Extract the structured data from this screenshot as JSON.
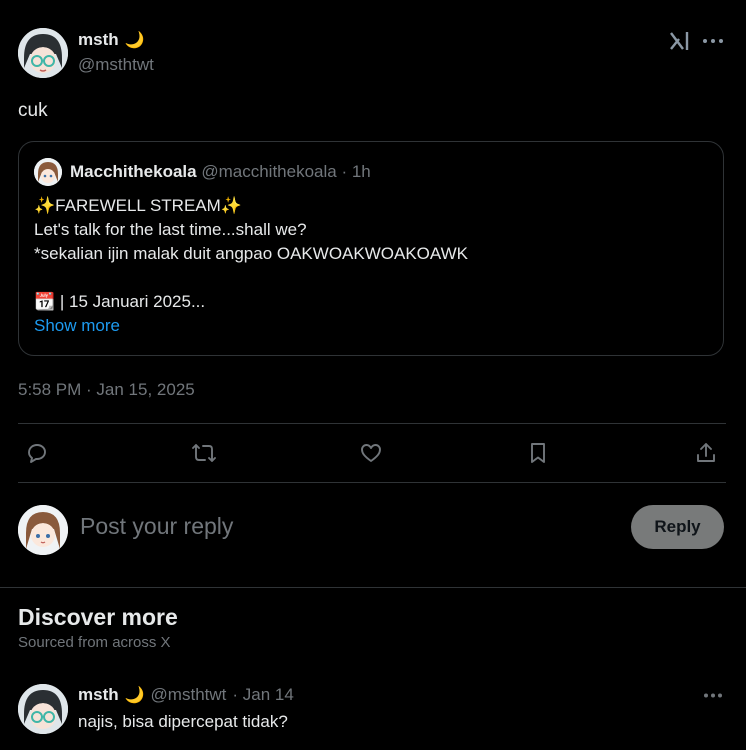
{
  "post": {
    "author_name": "msth",
    "author_emoji": "🌙",
    "author_handle": "@msthtwt",
    "text": "cuk",
    "timestamp": "5:58 PM · Jan 15, 2025"
  },
  "quote": {
    "author_name": "Macchithekoala",
    "author_handle": "@macchithekoala",
    "time": "· 1h",
    "line1": "✨FAREWELL STREAM✨",
    "line2": "Let's talk for the last time...shall we?",
    "line3": "*sekalian ijin malak duit angpao OAKWOAKWOAKOAWK",
    "line4": "📆 | 15 Januari 2025...",
    "show_more": "Show more"
  },
  "actions": [
    "reply-icon",
    "repost-icon",
    "like-icon",
    "bookmark-icon",
    "share-icon"
  ],
  "reply_box": {
    "placeholder": "Post your reply",
    "button": "Reply"
  },
  "discover": {
    "title": "Discover more",
    "subtitle": "Sourced from across X"
  },
  "feed_post": {
    "author_name": "msth",
    "author_emoji": "🌙",
    "author_handle": "@msthtwt",
    "time": "· Jan 14",
    "text": "najis, bisa dipercepat tidak?"
  },
  "colors": {
    "background": "#000000",
    "text": "#e7e9ea",
    "muted": "#71767b",
    "link": "#1d9bf0",
    "border": "#2f3336",
    "reply_button": "#787a7a"
  }
}
